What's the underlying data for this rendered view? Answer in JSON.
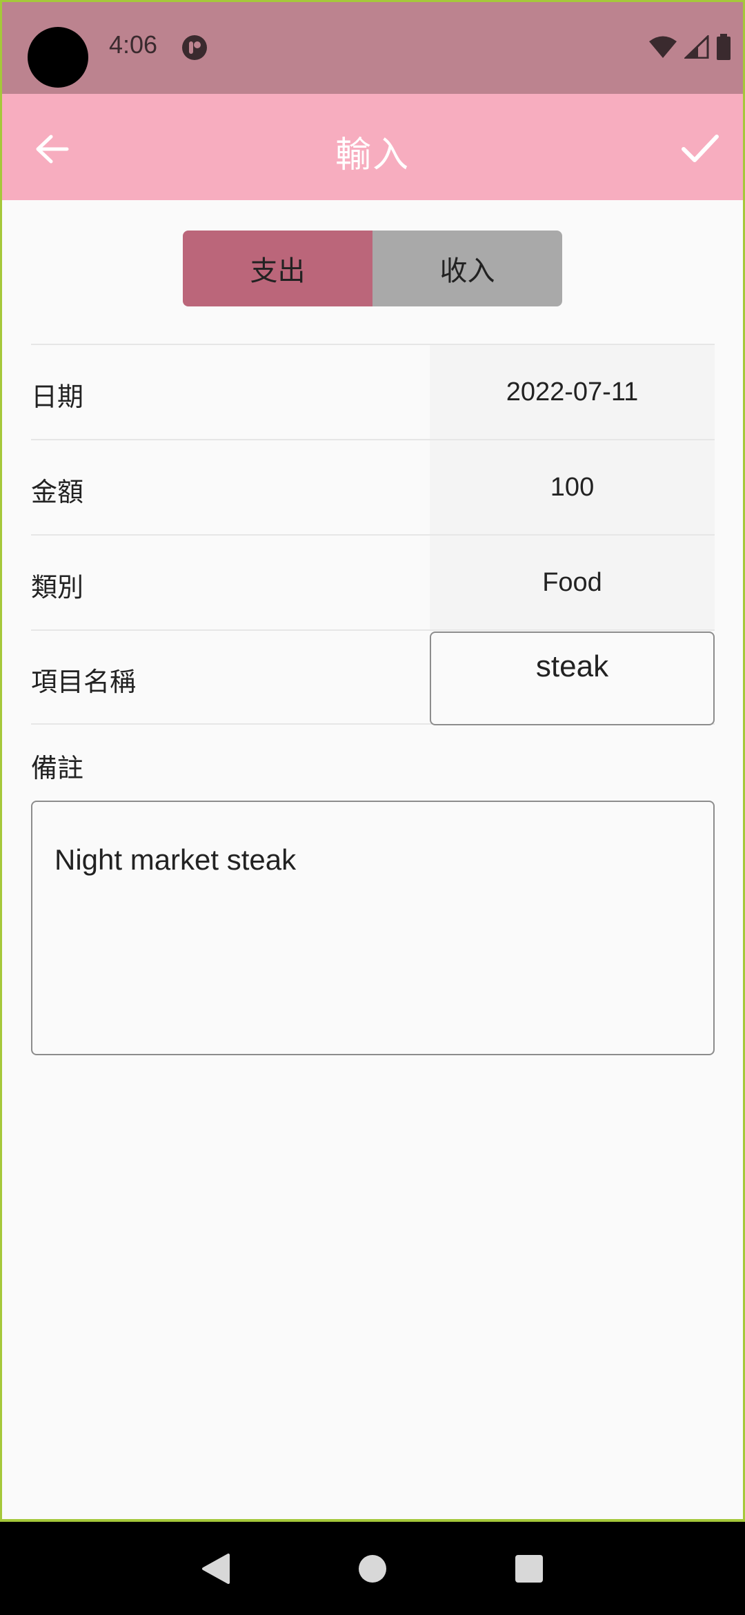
{
  "status_bar": {
    "time": "4:06"
  },
  "app_bar": {
    "title": "輸入"
  },
  "segmented": {
    "expense": "支出",
    "income": "收入",
    "selected": "expense"
  },
  "form": {
    "date": {
      "label": "日期",
      "value": "2022-07-11"
    },
    "amount": {
      "label": "金額",
      "value": "100"
    },
    "category": {
      "label": "類別",
      "value": "Food"
    },
    "item_name": {
      "label": "項目名稱",
      "value": "steak"
    },
    "note": {
      "label": "備註",
      "value": "Night market steak"
    }
  },
  "colors": {
    "status_bar": "#bc838f",
    "app_bar": "#f7adbf",
    "segment_active": "#bb667a",
    "segment_inactive": "#a9a9a9"
  },
  "icons": {
    "back": "arrow-back-icon",
    "confirm": "check-icon",
    "nav_back": "triangle-back-icon",
    "nav_home": "circle-home-icon",
    "nav_recents": "square-recents-icon"
  }
}
